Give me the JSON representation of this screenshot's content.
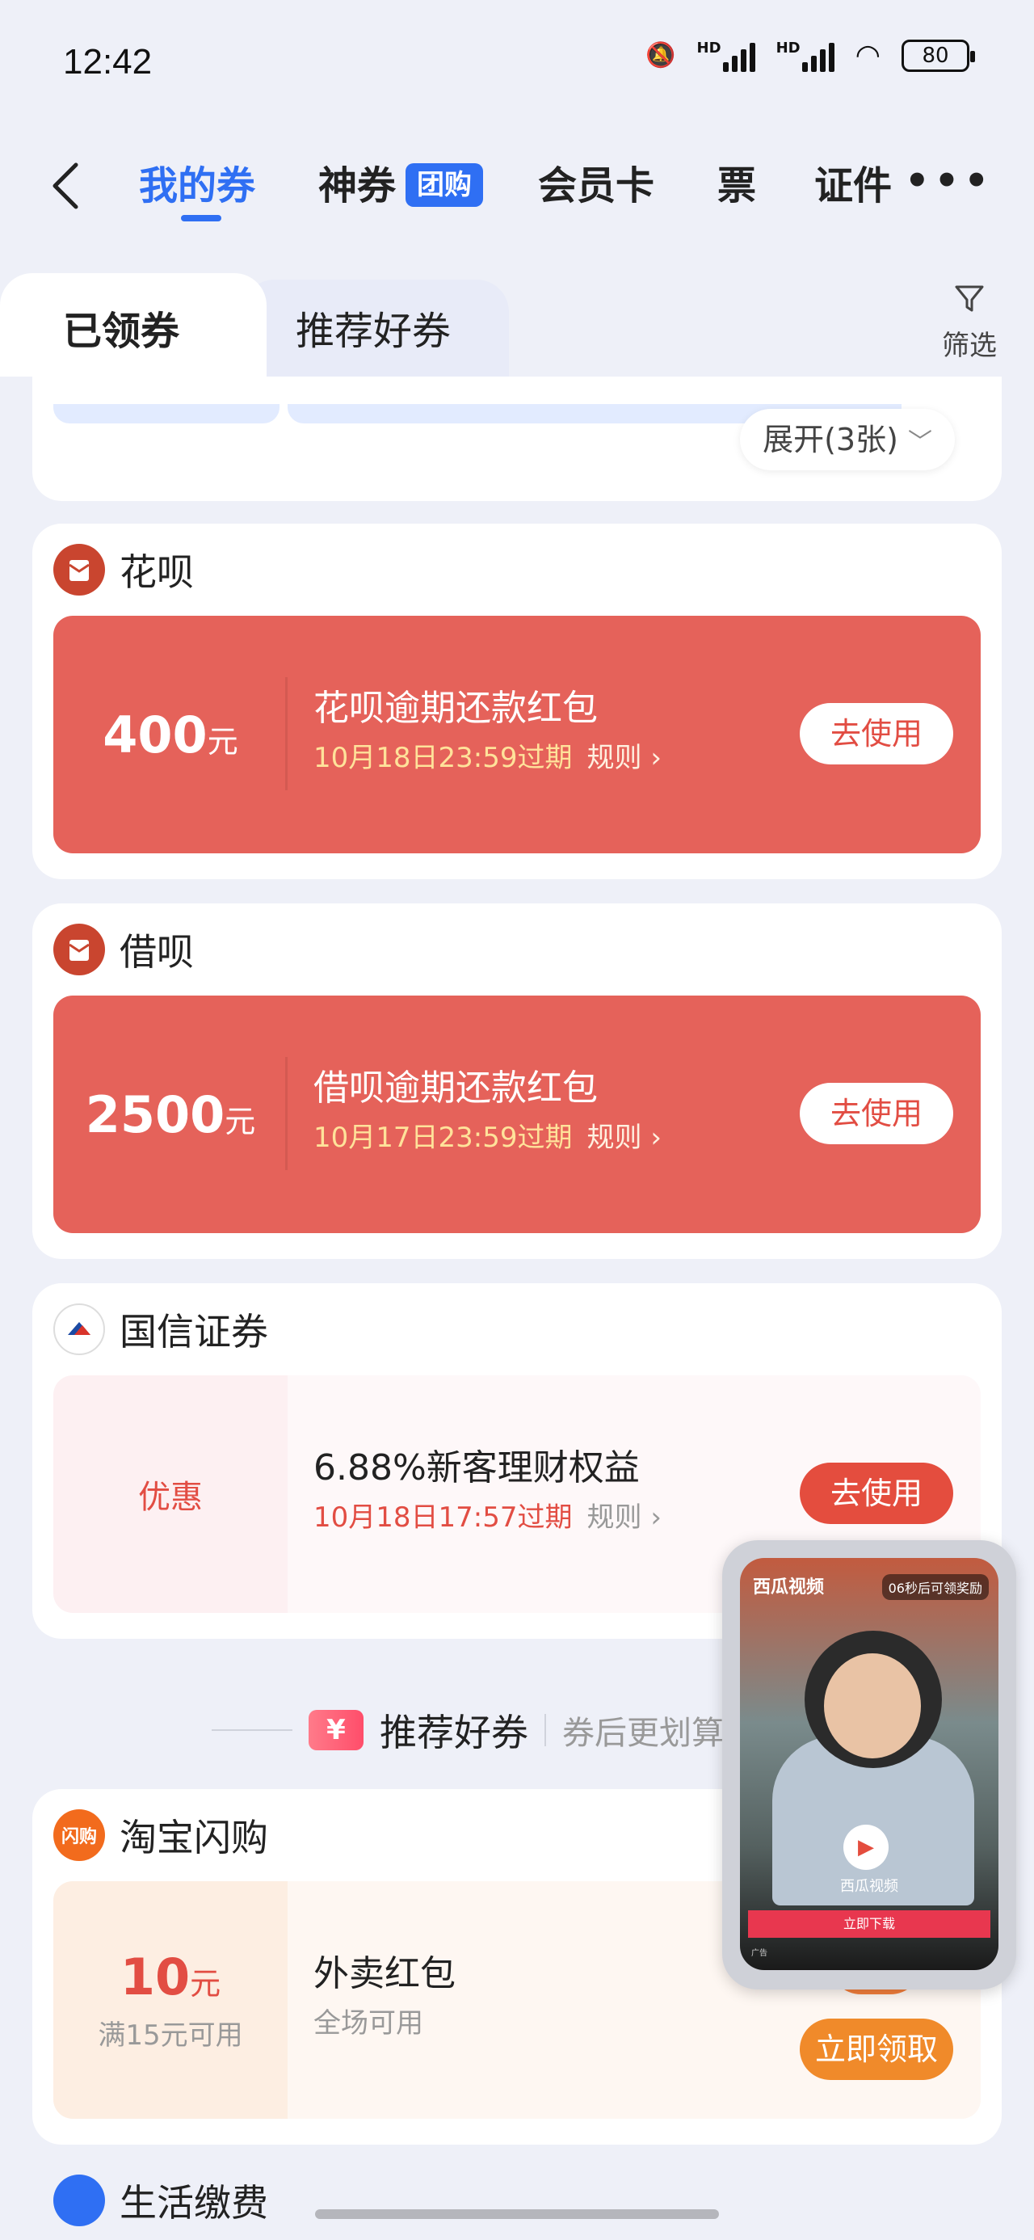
{
  "status_bar": {
    "time": "12:42",
    "battery": "80",
    "network": "HD"
  },
  "nav": {
    "tabs": [
      {
        "label": "我的券"
      },
      {
        "label": "神券"
      },
      {
        "label": "会员卡"
      },
      {
        "label": "票"
      },
      {
        "label": "证件"
      }
    ],
    "badge": "团购",
    "more": "•••"
  },
  "subtabs": {
    "active": "已领券",
    "inactive": "推荐好券",
    "filter": "筛选"
  },
  "expand_label": "展开(3张)",
  "coupons": [
    {
      "brand": "花呗",
      "amount": "400",
      "unit": "元",
      "title": "花呗逾期还款红包",
      "expiry": "10月18日23:59过期",
      "rule": "规则",
      "button": "去使用",
      "style": "red"
    },
    {
      "brand": "借呗",
      "amount": "2500",
      "unit": "元",
      "title": "借呗逾期还款红包",
      "expiry": "10月17日23:59过期",
      "rule": "规则",
      "button": "去使用",
      "style": "red"
    },
    {
      "brand": "国信证券",
      "amount_label": "优惠",
      "title": "6.88%新客理财权益",
      "expiry": "10月18日17:57过期",
      "rule": "规则",
      "button": "去使用",
      "style": "pink"
    }
  ],
  "recommend": {
    "title": "推荐好券",
    "subtitle": "券后更划算",
    "icon": "¥"
  },
  "taobao": {
    "brand": "淘宝闪购",
    "icon_text": "闪购",
    "amount": "10",
    "unit": "元",
    "condition": "满15元可用",
    "title": "外卖红包",
    "scope": "全场可用",
    "button": "立即领取",
    "stamp": "闪购"
  },
  "next_section": "生活缴费",
  "video": {
    "app": "西瓜视频",
    "skip": "06秒后可领奖励",
    "name": "西瓜视频",
    "download": "立即下载",
    "tag": "广告"
  },
  "colors": {
    "accent": "#2f6ff3",
    "coupon_red": "#e5625a",
    "text_red": "#e24d43",
    "orange": "#f08a2a"
  }
}
